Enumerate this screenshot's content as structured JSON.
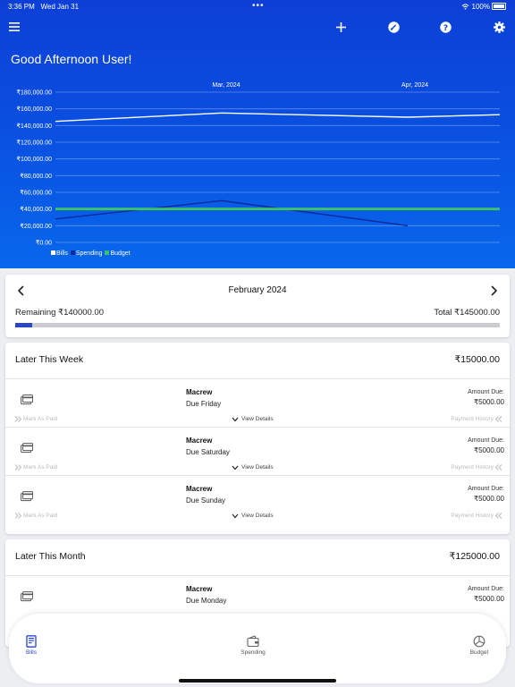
{
  "status": {
    "time": "3:36 PM",
    "date": "Wed Jan 31",
    "dots": "•••",
    "battery": "100%"
  },
  "greeting": "Good Afternoon User!",
  "chart_data": {
    "type": "line",
    "x_categories": [
      "Mar, 2024",
      "Apr, 2024"
    ],
    "y_ticks": [
      "₹180,000.00",
      "₹160,000.00",
      "₹140,000.00",
      "₹120,000.00",
      "₹100,000.00",
      "₹80,000.00",
      "₹60,000.00",
      "₹40,000.00",
      "₹20,000.00",
      "₹0.00"
    ],
    "ylim": [
      0,
      180000
    ],
    "series": [
      {
        "name": "Bills",
        "color": "#ffffff",
        "values": [
          145000,
          155000,
          150000,
          153000
        ]
      },
      {
        "name": "Spending",
        "color": "#0a2a9a",
        "values": [
          28000,
          50000,
          20000
        ]
      },
      {
        "name": "Budget",
        "color": "#3ec06a",
        "values": [
          40000,
          40000,
          40000,
          40000
        ]
      }
    ],
    "grid": true,
    "legend": "bottom-left"
  },
  "month_nav": {
    "title": "February 2024",
    "remaining": "Remaining ₹140000.00",
    "total": "Total ₹145000.00",
    "progress_fraction": 0.035
  },
  "sections": [
    {
      "title": "Later This Week",
      "amount": "₹15000.00",
      "bills": [
        {
          "name": "Macrew",
          "due": "Due Friday",
          "amount_label": "Amount Due:",
          "amount": "₹5000.00",
          "mark": "Mark As Paid",
          "view": "View Details",
          "history": "Payment History"
        },
        {
          "name": "Macrew",
          "due": "Due Saturday",
          "amount_label": "Amount Due:",
          "amount": "₹5000.00",
          "mark": "Mark As Paid",
          "view": "View Details",
          "history": "Payment History"
        },
        {
          "name": "Macrew",
          "due": "Due Sunday",
          "amount_label": "Amount Due:",
          "amount": "₹5000.00",
          "mark": "Mark As Paid",
          "view": "View Details",
          "history": "Payment History"
        }
      ]
    },
    {
      "title": "Later This Month",
      "amount": "₹125000.00",
      "bills": [
        {
          "name": "Macrew",
          "due": "Due Monday",
          "amount_label": "Amount Due:",
          "amount": "₹5000.00"
        }
      ]
    }
  ],
  "tabs": [
    {
      "label": "Bills",
      "icon": "bills-icon",
      "active": true
    },
    {
      "label": "Spending",
      "icon": "wallet-icon",
      "active": false
    },
    {
      "label": "Budget",
      "icon": "budget-icon",
      "active": false
    }
  ],
  "colors": {
    "header_top": "#0d3fd6",
    "header_bottom": "#0867ec",
    "accent": "#2747c8",
    "budget_line": "#3ec06a"
  }
}
